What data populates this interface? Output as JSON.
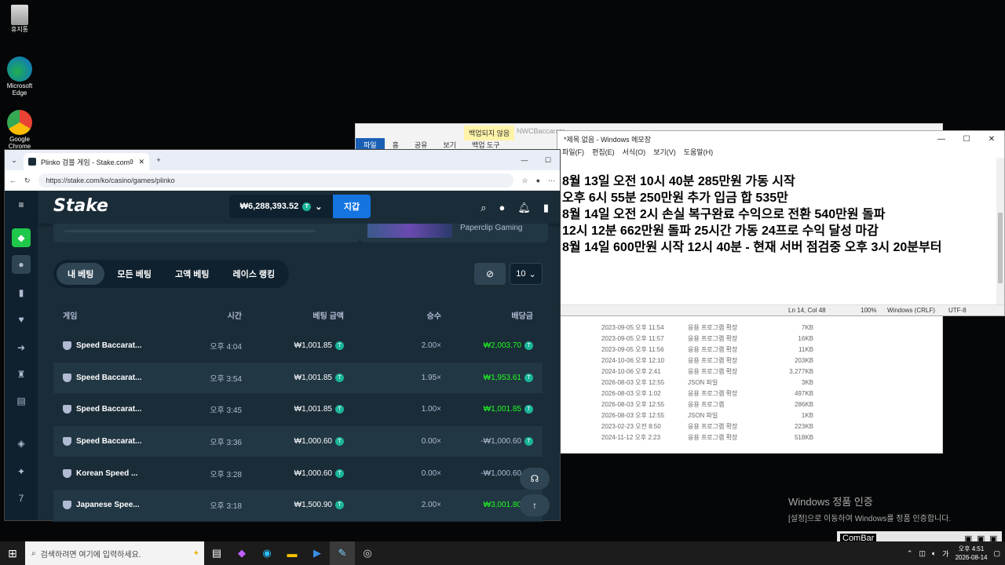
{
  "desktop": {
    "icons": [
      {
        "label": "휴지통"
      },
      {
        "label": "Microsoft Edge"
      },
      {
        "label": "Google Chrome"
      }
    ]
  },
  "explorer": {
    "tabs": [
      "파일",
      "홈",
      "공유",
      "보기",
      "백업 도구"
    ],
    "badge": "백업되지 않음",
    "title": "NWCBaccaratc...",
    "files": [
      {
        "date": "2023-09-05 오후 11:54",
        "type": "응용 프로그램 확장",
        "size": "7KB"
      },
      {
        "date": "2023-09-05 오후 11:57",
        "type": "응용 프로그램 확장",
        "size": "16KB"
      },
      {
        "date": "2023-09-05 오후 11:56",
        "type": "응용 프로그램 확장",
        "size": "11KB"
      },
      {
        "date": "2024-10-06 오후 12:10",
        "type": "응용 프로그램 확장",
        "size": "203KB"
      },
      {
        "date": "2024-10-06 오후 2:41",
        "type": "응용 프로그램 확장",
        "size": "3,277KB"
      },
      {
        "date": "2026-08-03 오후 12:55",
        "type": "JSON 파일",
        "size": "3KB"
      },
      {
        "date": "2026-08-03 오후 1:02",
        "type": "응용 프로그램 확장",
        "size": "497KB"
      },
      {
        "date": "2026-08-03 오후 12:55",
        "type": "응용 프로그램",
        "size": "286KB"
      },
      {
        "date": "2026-08-03 오후 12:55",
        "type": "JSON 파일",
        "size": "1KB"
      },
      {
        "date": "2023-02-23 오전 8:50",
        "type": "응용 프로그램 확장",
        "size": "223KB"
      },
      {
        "date": "2024-11-12 오후 2:23",
        "type": "응용 프로그램 확장",
        "size": "518KB"
      }
    ]
  },
  "notepad": {
    "title": "*제목 없음 - Windows 메모장",
    "menu": [
      "파일(F)",
      "편집(E)",
      "서식(O)",
      "보기(V)",
      "도움말(H)"
    ],
    "lines": [
      "8월 13일 오전 10시 40분 285만원 가동 시작",
      "오후 6시 55분 250만원 추가 입금 합 535만",
      "",
      "8월 14일 오전 2시 손실 복구완료 수익으로 전환 540만원 돌파",
      "12시 12분 662만원 돌파 25시간 가동 24프로 수익 달성 마감",
      "",
      "8월 14일 600만원 시작 12시 40분 - 현재 서버 점검중 오후 3시 20분부터"
    ],
    "status": {
      "pos": "Ln 14, Col 48",
      "zoom": "100%",
      "eol": "Windows (CRLF)",
      "enc": "UTF-8"
    }
  },
  "browser": {
    "tab_title": "Plinko 검블 게임 - Stake.com에서",
    "url": "https://stake.com/ko/casino/games/plinko"
  },
  "stake": {
    "logo": "Stake",
    "balance": "₩6,288,393.52",
    "wallet_label": "지갑",
    "promo_text": "Paperclip Gaming",
    "tabs": [
      "내 베팅",
      "모든 베팅",
      "고액 베팅",
      "레이스 랭킹"
    ],
    "page_size": "10",
    "columns": [
      "게임",
      "시간",
      "베팅 금액",
      "승수",
      "배당금"
    ],
    "rows": [
      {
        "game": "Speed Baccarat...",
        "time": "오후 4:04",
        "bet": "₩1,001.85",
        "mult": "2.00×",
        "payout": "₩2,003.70",
        "win": true
      },
      {
        "game": "Speed Baccarat...",
        "time": "오후 3:54",
        "bet": "₩1,001.85",
        "mult": "1.95×",
        "payout": "₩1,953.61",
        "win": true
      },
      {
        "game": "Speed Baccarat...",
        "time": "오후 3:45",
        "bet": "₩1,001.85",
        "mult": "1.00×",
        "payout": "₩1,001.85",
        "win": true
      },
      {
        "game": "Speed Baccarat...",
        "time": "오후 3:36",
        "bet": "₩1,000.60",
        "mult": "0.00×",
        "payout": "-₩1,000.60",
        "win": false
      },
      {
        "game": "Korean Speed ...",
        "time": "오후 3:28",
        "bet": "₩1,000.60",
        "mult": "0.00×",
        "payout": "-₩1,000.60",
        "win": false
      },
      {
        "game": "Japanese Spee...",
        "time": "오후 3:18",
        "bet": "₩1,500.90",
        "mult": "2.00×",
        "payout": "₩3,001.80",
        "win": true
      }
    ],
    "colors": {
      "bg": "#1a2c38",
      "sidebar": "#0f212e",
      "accent": "#1475e1",
      "win": "#1fff20"
    }
  },
  "watermark": {
    "title": "Windows 정품 인증",
    "sub": "[설정]으로 이동하여 Windows를 정품 인증합니다."
  },
  "combar": {
    "label": "ComBar"
  },
  "taskbar": {
    "search_placeholder": "검색하려면 여기에 입력하세요.",
    "time": "오후 4:51",
    "date": "2026-08-14",
    "lang": "가"
  }
}
